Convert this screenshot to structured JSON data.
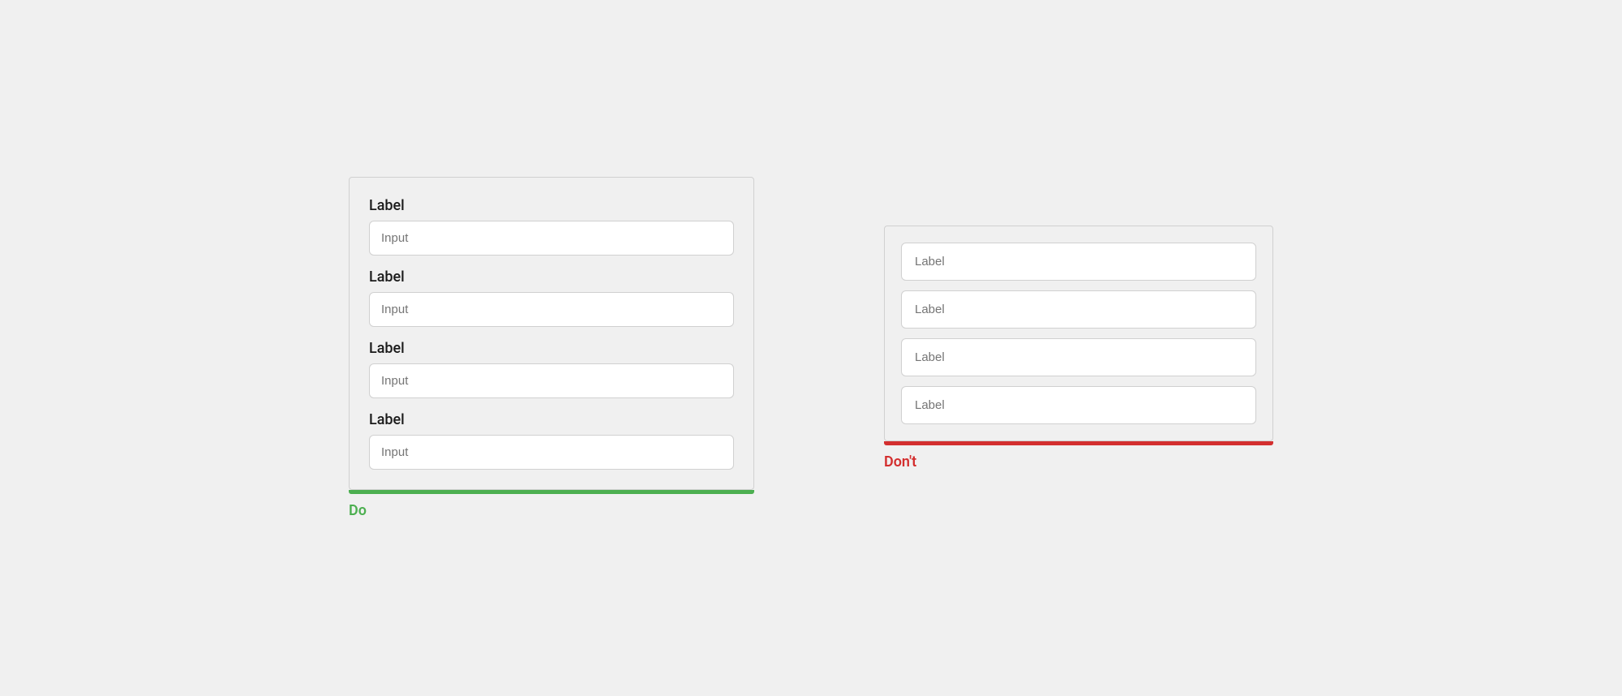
{
  "do_example": {
    "card_aria": "do-example",
    "fields": [
      {
        "label": "Label",
        "placeholder": "Input"
      },
      {
        "label": "Label",
        "placeholder": "Input"
      },
      {
        "label": "Label",
        "placeholder": "Input"
      },
      {
        "label": "Label",
        "placeholder": "Input"
      }
    ],
    "indicator_color": "#4caf50",
    "example_label": "Do",
    "label_color": "#4caf50"
  },
  "dont_example": {
    "card_aria": "dont-example",
    "fields": [
      {
        "placeholder": "Label"
      },
      {
        "placeholder": "Label"
      },
      {
        "placeholder": "Label"
      },
      {
        "placeholder": "Label"
      }
    ],
    "indicator_color": "#d32f2f",
    "example_label": "Don't",
    "label_color": "#d32f2f"
  }
}
